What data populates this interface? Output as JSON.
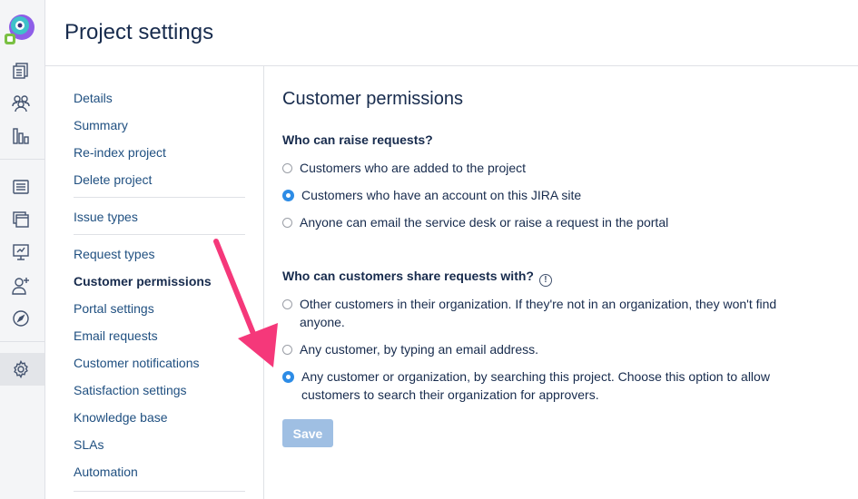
{
  "app": {
    "page_title": "Project settings"
  },
  "rail_icons": [
    "app-logo-icon",
    "queues-icon",
    "customers-icon",
    "reports-icon",
    "knowledge-base-icon",
    "portal-icon",
    "raise-request-icon",
    "invite-team-icon",
    "explore-icon",
    "settings-icon"
  ],
  "sidebar": {
    "items": [
      {
        "label": "Details"
      },
      {
        "label": "Summary"
      },
      {
        "label": "Re-index project"
      },
      {
        "label": "Delete project"
      },
      {
        "label": "Issue types"
      },
      {
        "label": "Request types"
      },
      {
        "label": "Customer permissions",
        "current": true
      },
      {
        "label": "Portal settings"
      },
      {
        "label": "Email requests"
      },
      {
        "label": "Customer notifications"
      },
      {
        "label": "Satisfaction settings"
      },
      {
        "label": "Knowledge base"
      },
      {
        "label": "SLAs"
      },
      {
        "label": "Automation"
      }
    ]
  },
  "main": {
    "title": "Customer permissions",
    "raise_question": "Who can raise requests?",
    "raise_options": [
      {
        "label": "Customers who are added to the project",
        "selected": false
      },
      {
        "label": "Customers who have an account on this JIRA site",
        "selected": true
      },
      {
        "label": "Anyone can email the service desk or raise a request in the portal",
        "selected": false
      }
    ],
    "share_question": "Who can customers share requests with?",
    "share_info_icon": "!",
    "share_options": [
      {
        "label": "Other customers in their organization. If they're not in an organization, they won't find anyone.",
        "selected": false
      },
      {
        "label": "Any customer, by typing an email address.",
        "selected": false
      },
      {
        "label": "Any customer or organization, by searching this project. Choose this option to allow customers to search their organization for approvers.",
        "selected": true
      }
    ],
    "save_label": "Save"
  },
  "colors": {
    "link": "#205081",
    "radio_selected": "#2d8ce6",
    "save_disabled": "#9fbfe3",
    "annotation_arrow": "#f5387a"
  }
}
